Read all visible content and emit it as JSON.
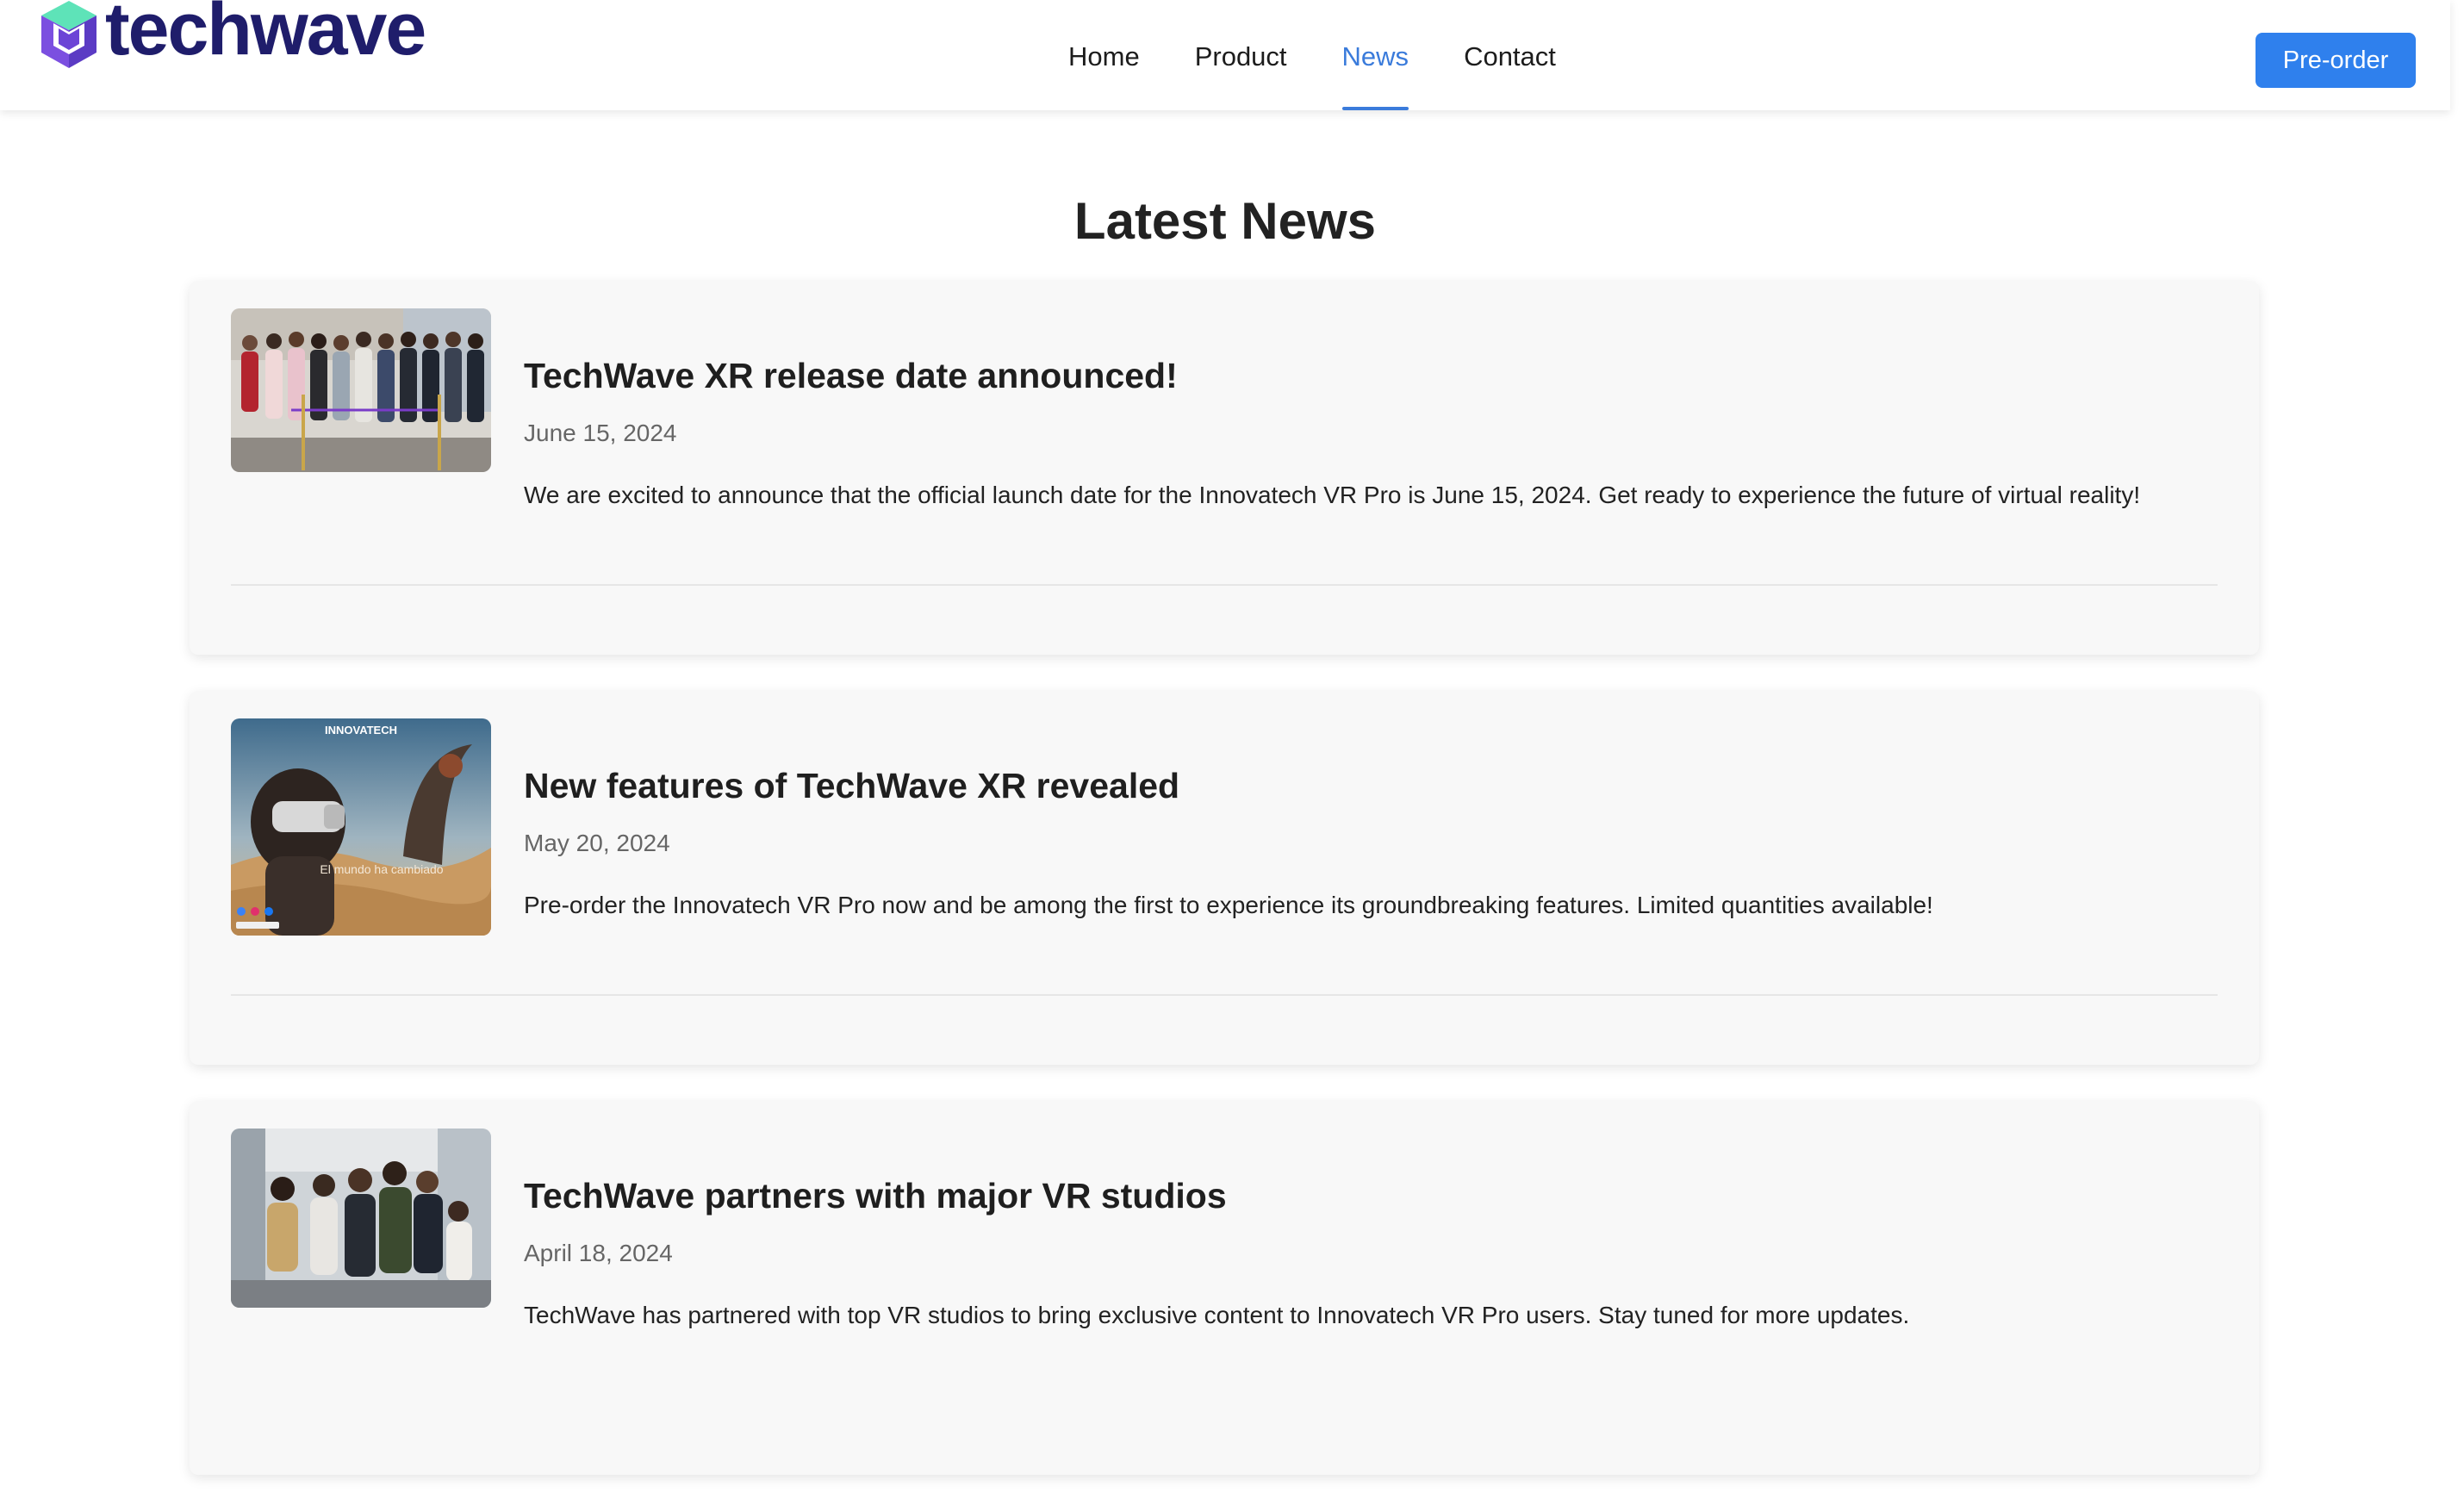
{
  "brand": {
    "name": "techwave",
    "colors": {
      "logo_text": "#1f1d6b",
      "logo_mark_top": "#5ee3b8",
      "logo_mark_left": "#7b4fe0",
      "logo_mark_right": "#5b3bc4"
    }
  },
  "nav": {
    "items": [
      {
        "label": "Home",
        "active": false
      },
      {
        "label": "Product",
        "active": false
      },
      {
        "label": "News",
        "active": true
      },
      {
        "label": "Contact",
        "active": false
      }
    ],
    "active_color": "#3a7bdb"
  },
  "header": {
    "cta_label": "Pre-order",
    "cta_color": "#2f80ed"
  },
  "main": {
    "title": "Latest News",
    "articles": [
      {
        "title": "TechWave XR release date announced!",
        "date": "June 15, 2024",
        "text": "We are excited to announce that the official launch date for the Innovatech VR Pro is June 15, 2024. Get ready to experience the future of virtual reality!",
        "image_icon": "group-ribbon-cutting-photo"
      },
      {
        "title": "New features of TechWave XR revealed",
        "date": "May 20, 2024",
        "text": "Pre-order the Innovatech VR Pro now and be among the first to experience its groundbreaking features. Limited quantities available!",
        "image_icon": "vr-headset-desert-photo",
        "image_caption_brand": "INNOVATECH",
        "image_caption": "El mundo ha cambiado"
      },
      {
        "title": "TechWave partners with major VR studios",
        "date": "April 18, 2024",
        "text": "TechWave has partnered with top VR studios to bring exclusive content to Innovatech VR Pro users. Stay tuned for more updates.",
        "image_icon": "team-group-photo"
      }
    ]
  }
}
